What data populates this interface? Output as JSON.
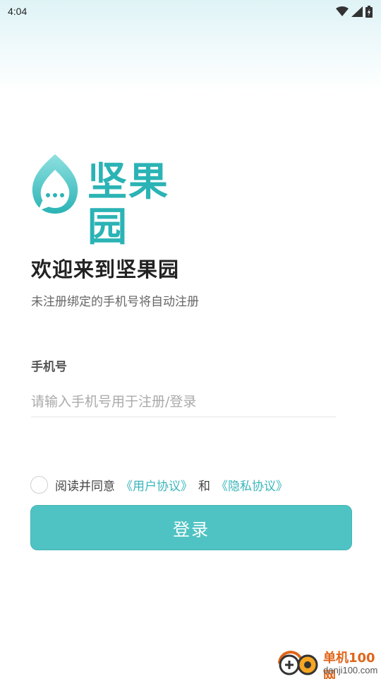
{
  "status_bar": {
    "time": "4:04",
    "icons": [
      "wifi-icon",
      "signal-icon",
      "battery-icon"
    ]
  },
  "logo": {
    "text": "坚果园",
    "color": "#2bb3b5"
  },
  "welcome": {
    "title": "欢迎来到坚果园",
    "subtitle": "未注册绑定的手机号将自动注册"
  },
  "phone": {
    "label": "手机号",
    "placeholder": "请输入手机号用于注册/登录",
    "value": ""
  },
  "agreement": {
    "checked": false,
    "prefix": "阅读并同意",
    "user_agreement": "《用户协议》",
    "and": "和",
    "privacy_policy": "《隐私协议》"
  },
  "login_button": {
    "label": "登录",
    "color": "#4fc3c3"
  },
  "watermark": {
    "title": "单机100网",
    "url": "danji100.com"
  }
}
